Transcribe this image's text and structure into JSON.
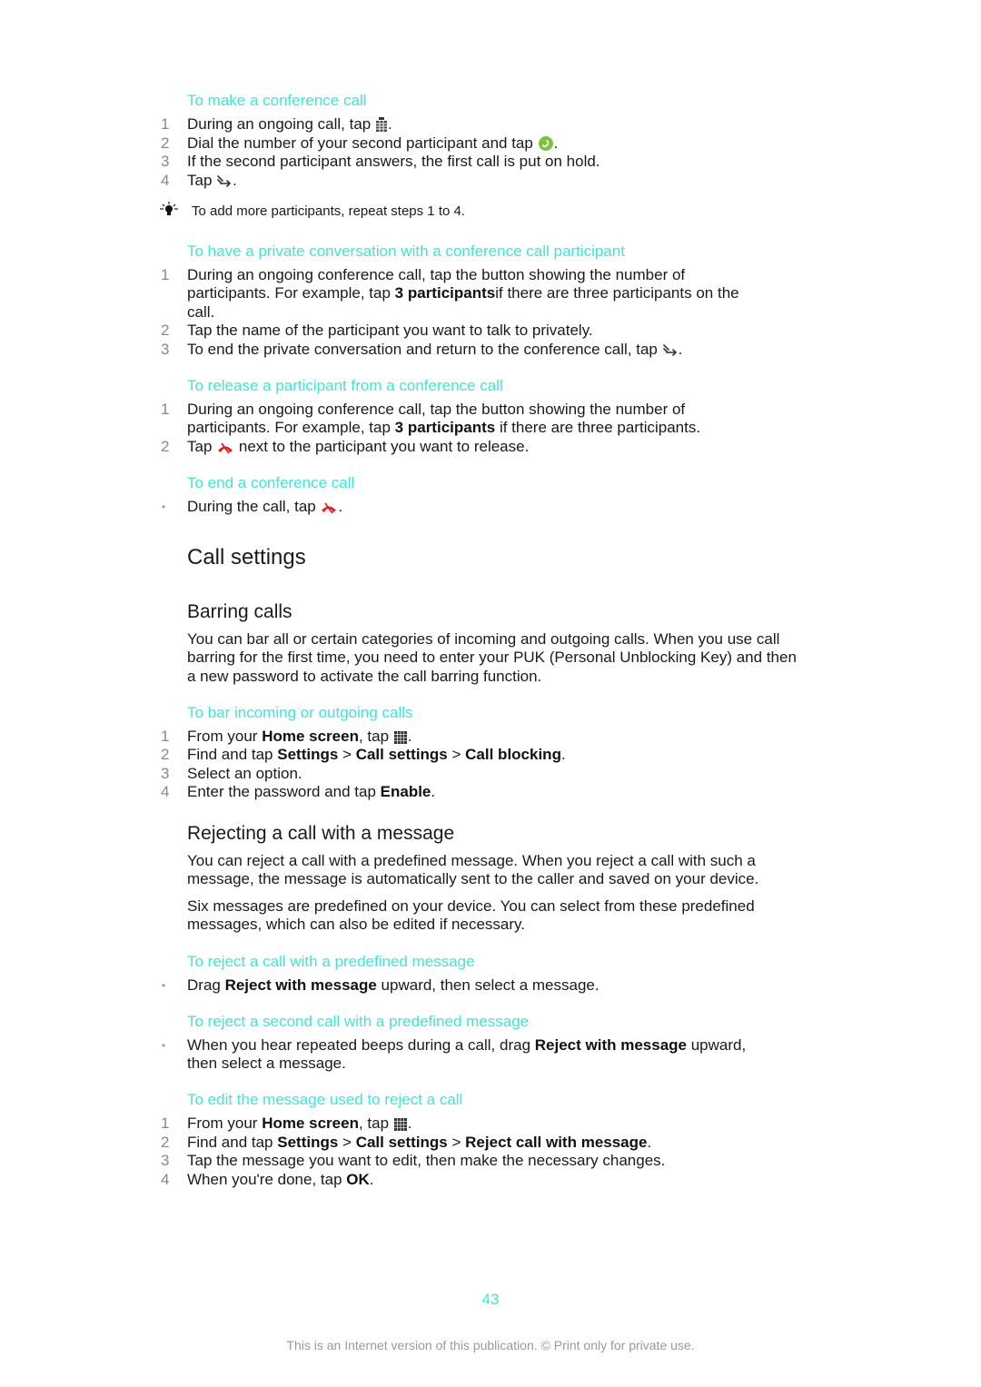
{
  "colors": {
    "accent": "#3ee6d6",
    "text": "#1a1a1a",
    "step_number": "#888888",
    "footer": "#999999",
    "end_call_icon": "#e02020",
    "call_icon": "#7cc242"
  },
  "conference": {
    "make": {
      "title": "To make a conference call",
      "steps": [
        {
          "n": "1",
          "pre": "During an ongoing call, tap",
          "icon": "dialpad-icon",
          "post": "."
        },
        {
          "n": "2",
          "pre": "Dial the number of your second participant and tap",
          "icon": "call-icon",
          "post": "."
        },
        {
          "n": "3",
          "text": "If the second participant answers, the first call is put on hold."
        },
        {
          "n": "4",
          "pre": "Tap",
          "icon": "merge-calls-icon",
          "post": "."
        }
      ],
      "tip": "To add more participants, repeat steps 1 to 4."
    },
    "private": {
      "title": "To have a private conversation with a conference call participant",
      "step1_line1": "During an ongoing conference call, tap the button showing the number of",
      "step1_line2_pre": "participants. For example, tap ",
      "step1_line2_bold": "3 participants",
      "step1_line2_post": "if there are three participants on the",
      "step1_line3": "call.",
      "step2": "Tap the name of the participant you want to talk to privately.",
      "step3_pre": "To end the private conversation and return to the conference call, tap",
      "step3_post": ".",
      "nums": [
        "1",
        "2",
        "3"
      ]
    },
    "release": {
      "title": "To release a participant from a conference call",
      "step1_line1": "During an ongoing conference call, tap the button showing the number of",
      "step1_line2_pre": "participants. For example, tap ",
      "step1_line2_bold": "3 participants",
      "step1_line2_post": " if there are three participants.",
      "step2_pre": "Tap",
      "step2_post": "next to the participant you want to release.",
      "nums": [
        "1",
        "2"
      ]
    },
    "end": {
      "title": "To end a conference call",
      "bullet": "•",
      "step_pre": "During the call, tap",
      "step_post": "."
    }
  },
  "call_settings": {
    "heading": "Call settings",
    "barring": {
      "heading": "Barring calls",
      "para_line1": "You can bar all or certain categories of incoming and outgoing calls. When you use call",
      "para_line2": "barring for the first time, you need to enter your PUK (Personal Unblocking Key) and then",
      "para_line3": "a new password to activate the call barring function.",
      "proc_title": "To bar incoming or outgoing calls",
      "nums": [
        "1",
        "2",
        "3",
        "4"
      ],
      "s1_pre": "From your ",
      "s1_bold": "Home screen",
      "s1_mid": ", tap",
      "s1_post": ".",
      "s2_pre": "Find and tap ",
      "s2_b1": "Settings",
      "s2_sep1": " > ",
      "s2_b2": "Call settings",
      "s2_sep2": " > ",
      "s2_b3": "Call blocking",
      "s2_post": ".",
      "s3": "Select an option.",
      "s4_pre": "Enter the password and tap ",
      "s4_bold": "Enable",
      "s4_post": "."
    },
    "reject": {
      "heading": "Rejecting a call with a message",
      "para1_line1": "You can reject a call with a predefined message. When you reject a call with such a",
      "para1_line2": "message, the message is automatically sent to the caller and saved on your device.",
      "para2_line1": "Six messages are predefined on your device. You can select from these predefined",
      "para2_line2": "messages, which can also be edited if necessary.",
      "proc1_title": "To reject a call with a predefined message",
      "proc1_pre": "Drag ",
      "proc1_bold": "Reject with message",
      "proc1_post": " upward, then select a message.",
      "proc2_title": "To reject a second call with a predefined message",
      "proc2_line1_pre": "When you hear repeated beeps during a call, drag ",
      "proc2_line1_bold": "Reject with message",
      "proc2_line1_post": " upward,",
      "proc2_line2": "then select a message.",
      "proc3_title": "To edit the message used to reject a call",
      "nums": [
        "1",
        "2",
        "3",
        "4"
      ],
      "s1_pre": "From your ",
      "s1_bold": "Home screen",
      "s1_mid": ", tap",
      "s1_post": ".",
      "s2_pre": "Find and tap ",
      "s2_b1": "Settings",
      "s2_sep1": " > ",
      "s2_b2": "Call settings",
      "s2_sep2": " > ",
      "s2_b3": "Reject call with message",
      "s2_post": ".",
      "s3": "Tap the message you want to edit, then make the necessary changes.",
      "s4_pre": "When you're done, tap ",
      "s4_bold": "OK",
      "s4_post": "."
    }
  },
  "bullet": "•",
  "page_number": "43",
  "footer": "This is an Internet version of this publication. © Print only for private use."
}
